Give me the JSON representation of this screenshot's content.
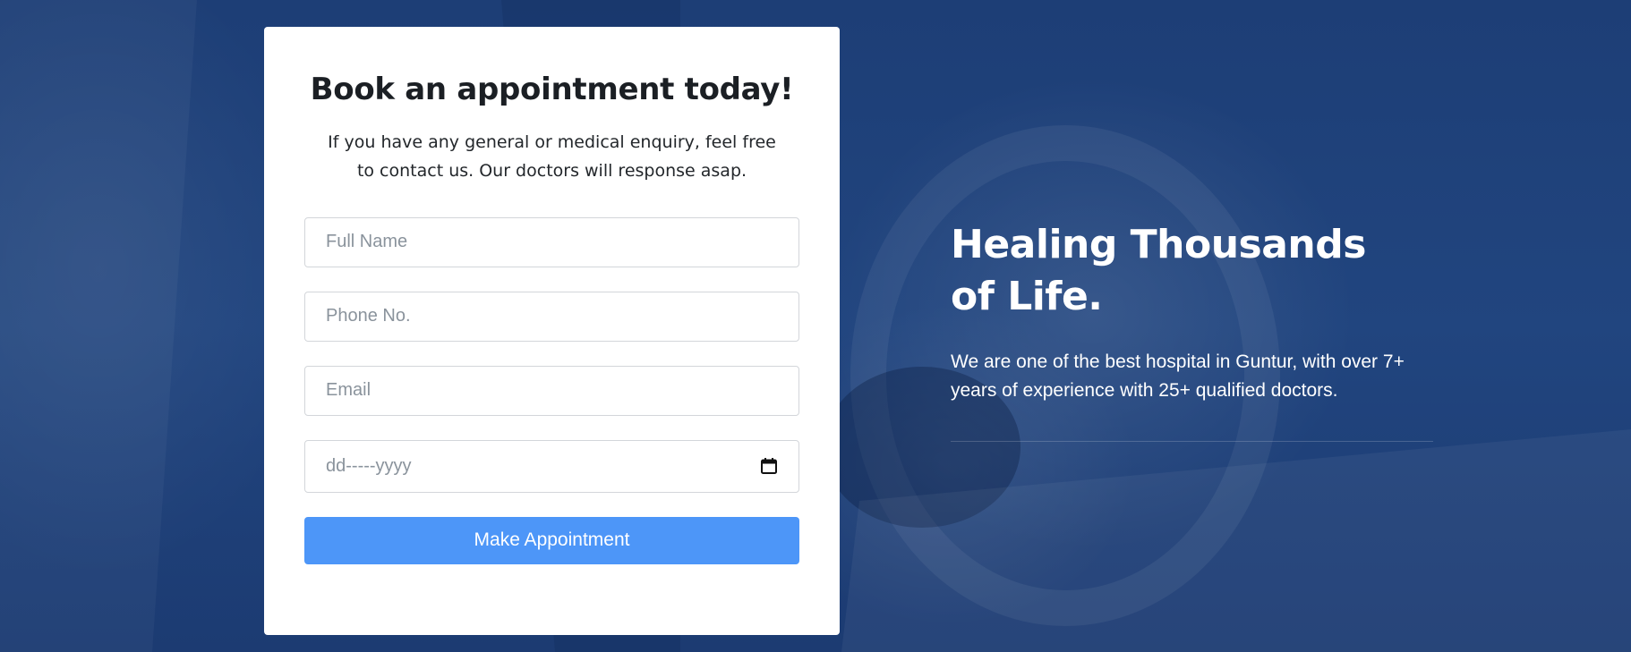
{
  "appointment_card": {
    "title": "Book an appointment today!",
    "description": "If you have any general or medical enquiry, feel free to contact us. Our doctors will response asap.",
    "fields": {
      "full_name_placeholder": "Full Name",
      "phone_placeholder": "Phone No.",
      "email_placeholder": "Email",
      "date_placeholder": "dd-----yyyy"
    },
    "submit_label": "Make Appointment"
  },
  "info": {
    "title": "Healing Thousands of Life.",
    "text": "We are one of the best hospital in Guntur, with over 7+ years of experience with 25+  qualified doctors."
  },
  "colors": {
    "background": "#1f427c",
    "button": "#4d96f8",
    "card": "#ffffff"
  },
  "icons": {
    "date_field_icon": "calendar-icon"
  }
}
